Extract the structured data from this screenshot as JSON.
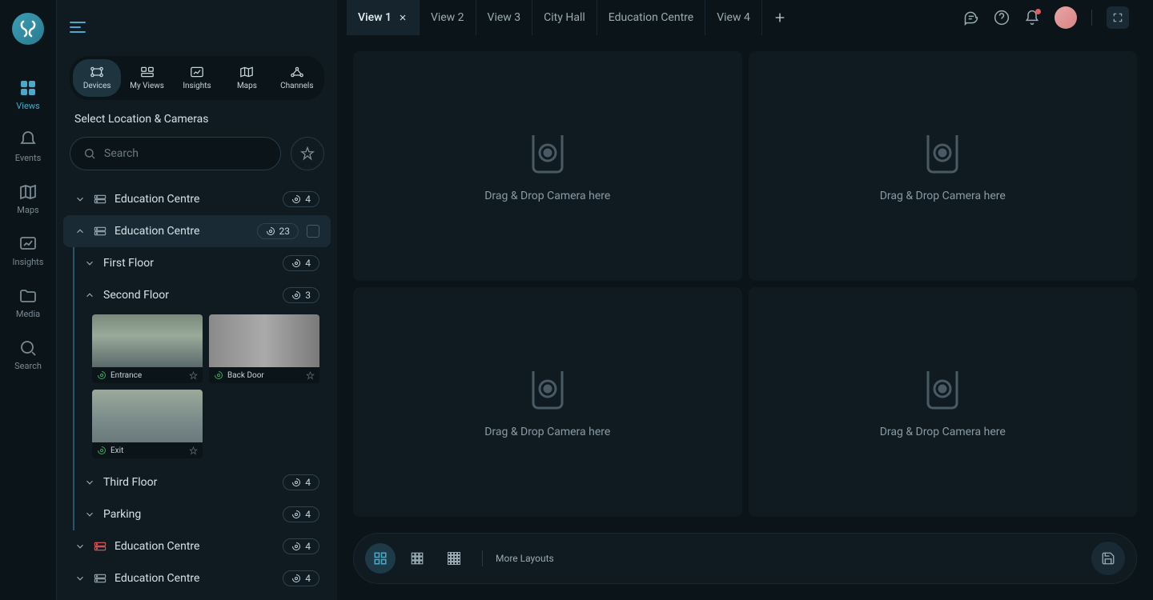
{
  "rail": {
    "items": [
      {
        "label": "Views",
        "icon": "grid-icon",
        "active": true
      },
      {
        "label": "Events",
        "icon": "bell-icon"
      },
      {
        "label": "Maps",
        "icon": "map-icon"
      },
      {
        "label": "Insights",
        "icon": "chart-icon"
      },
      {
        "label": "Media",
        "icon": "folder-icon"
      },
      {
        "label": "Search",
        "icon": "search-icon"
      }
    ]
  },
  "sidebar": {
    "tabs": [
      {
        "label": "Devices",
        "active": true
      },
      {
        "label": "My Views"
      },
      {
        "label": "Insights"
      },
      {
        "label": "Maps"
      },
      {
        "label": "Channels"
      }
    ],
    "title": "Select Location & Cameras",
    "search_placeholder": "Search",
    "tree": [
      {
        "name": "Education Centre",
        "count": "4",
        "expanded": false
      },
      {
        "name": "Education Centre",
        "count": "23",
        "expanded": true,
        "selected": true,
        "children": [
          {
            "name": "First Floor",
            "count": "4",
            "expanded": false
          },
          {
            "name": "Second Floor",
            "count": "3",
            "expanded": true,
            "cameras": [
              {
                "name": "Entrance"
              },
              {
                "name": "Back Door"
              },
              {
                "name": "Exit"
              }
            ]
          },
          {
            "name": "Third Floor",
            "count": "4",
            "expanded": false
          },
          {
            "name": "Parking",
            "count": "4",
            "expanded": false
          }
        ]
      },
      {
        "name": "Education Centre",
        "count": "4",
        "expanded": false,
        "error": true
      },
      {
        "name": "Education Centre",
        "count": "4",
        "expanded": false
      }
    ]
  },
  "tabs": {
    "items": [
      {
        "label": "View 1",
        "active": true,
        "closable": true
      },
      {
        "label": "View 2"
      },
      {
        "label": "View 3"
      },
      {
        "label": "City Hall"
      },
      {
        "label": "Education Centre"
      },
      {
        "label": "View 4"
      }
    ]
  },
  "grid": {
    "drop_message": "Drag & Drop Camera here"
  },
  "bottom": {
    "more_layouts": "More Layouts"
  }
}
